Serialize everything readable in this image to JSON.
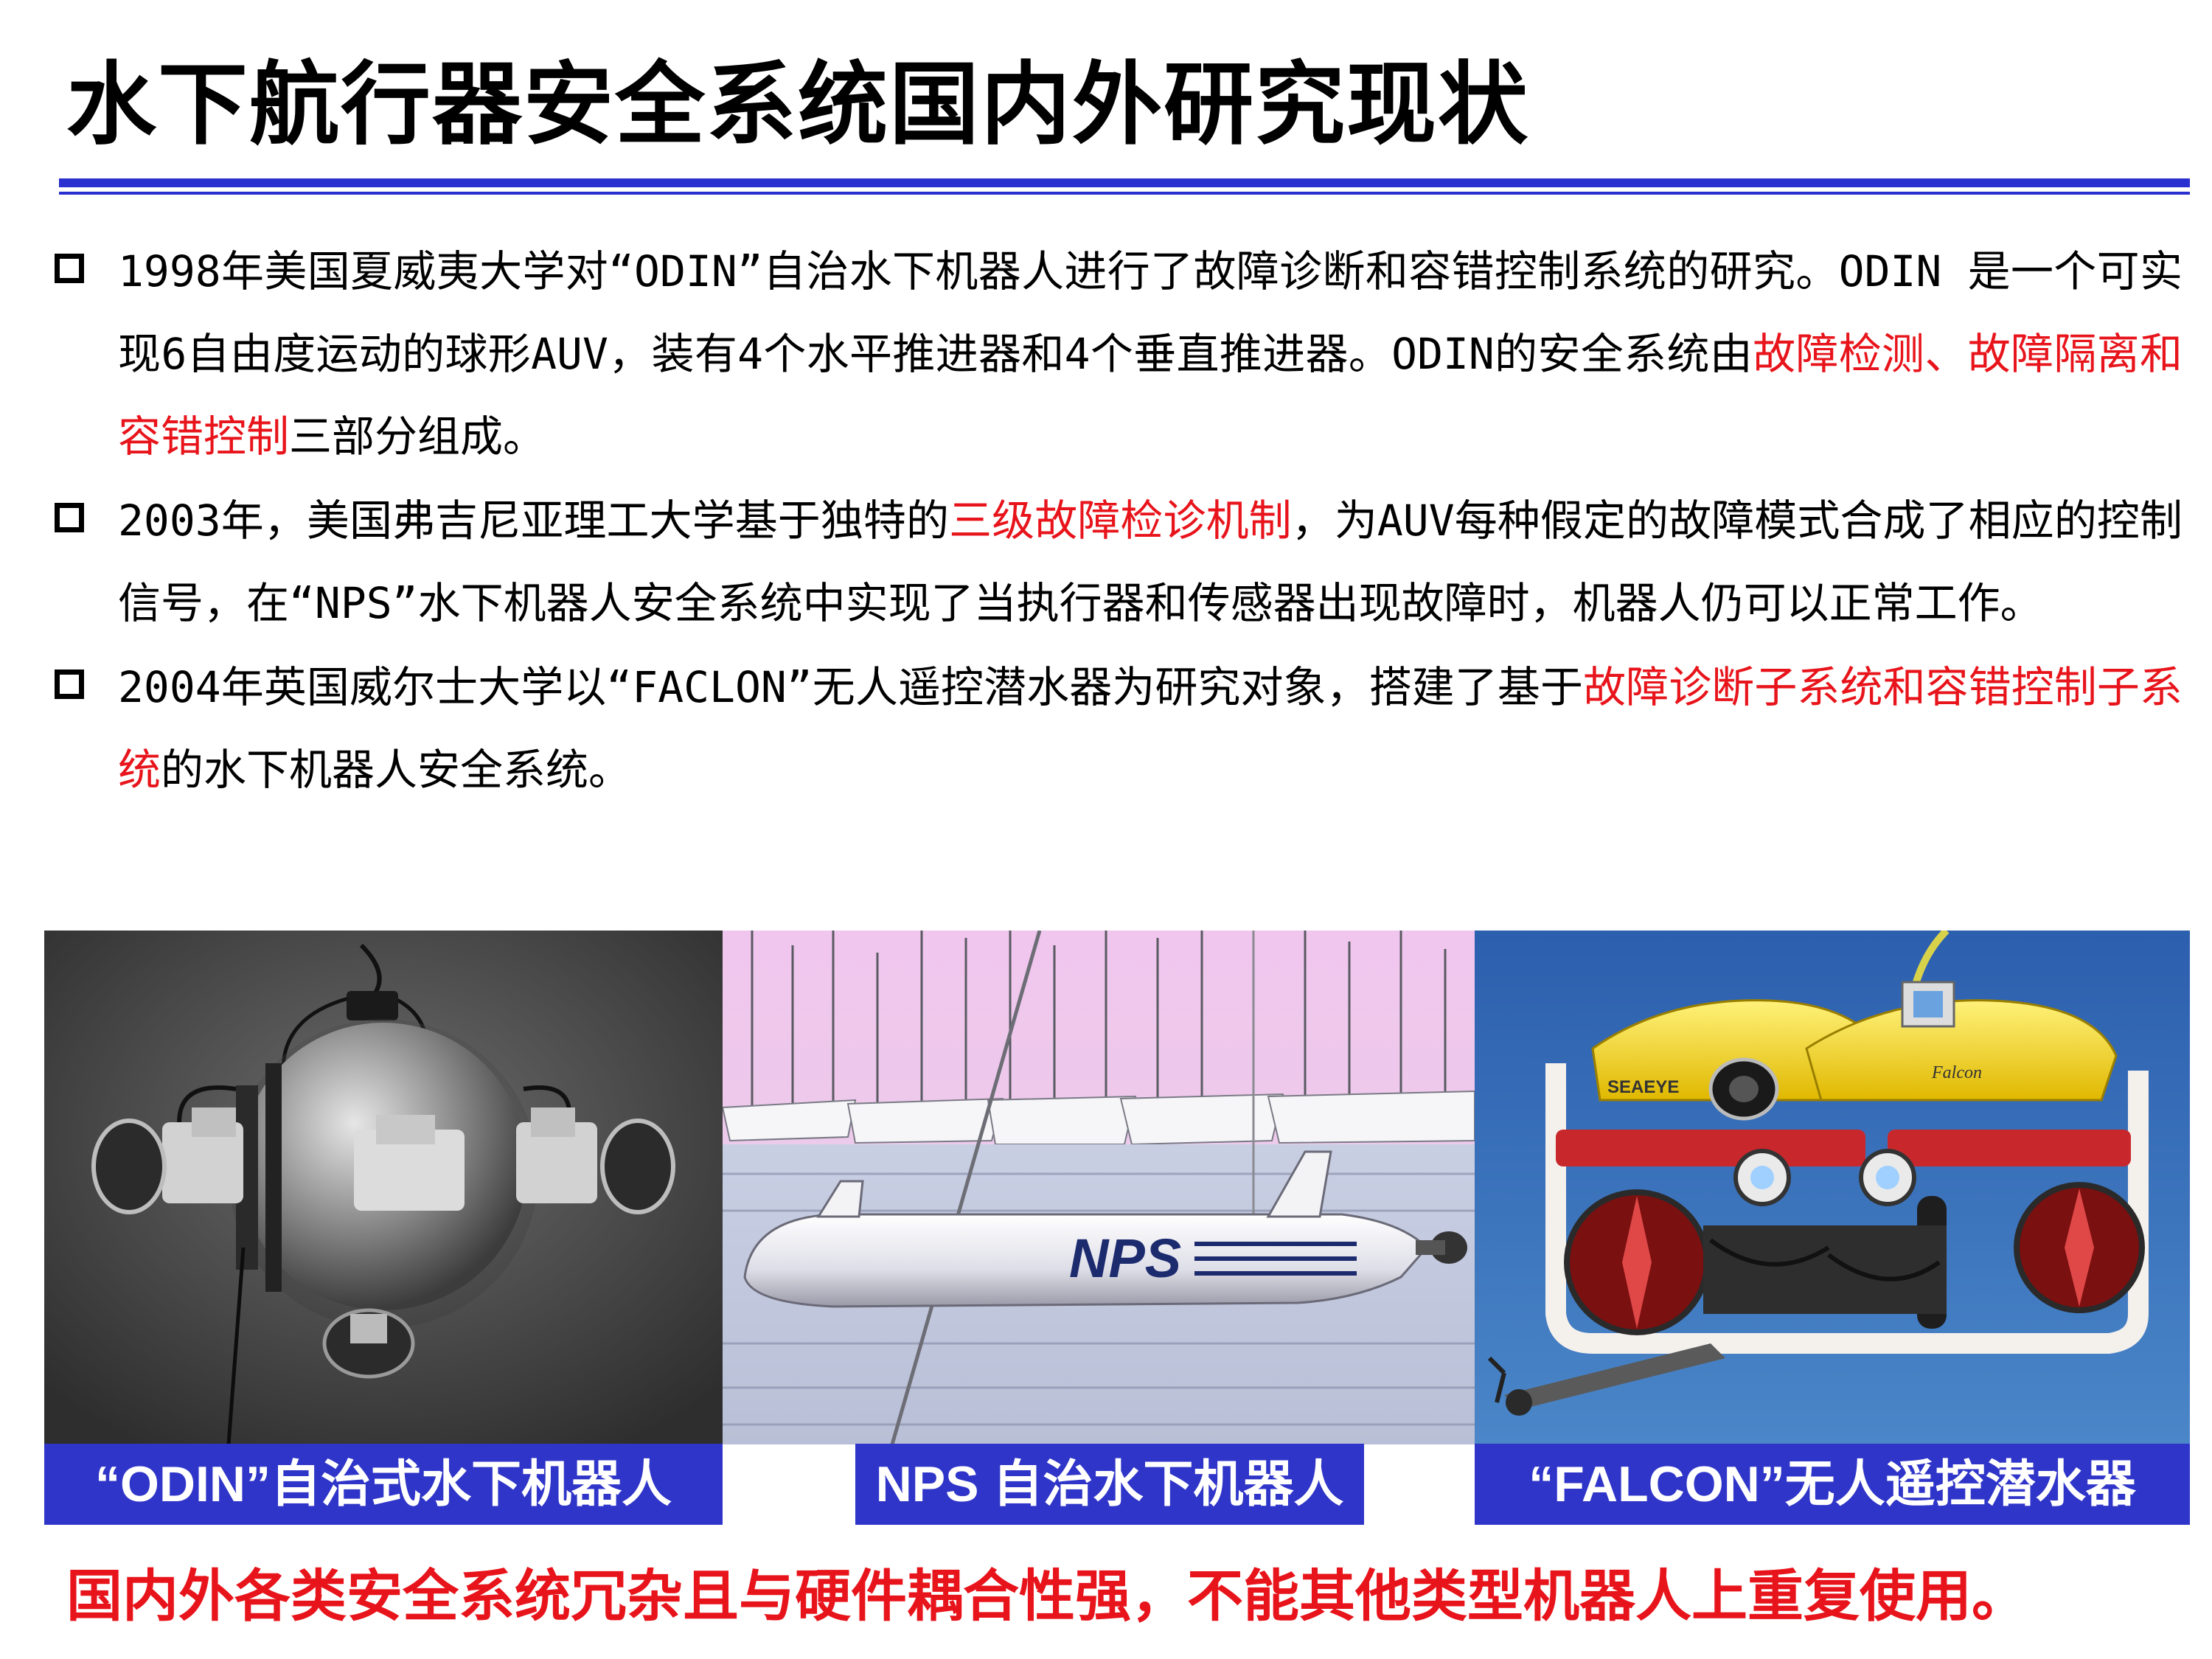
{
  "title": "水下航行器安全系统国内外研究现状",
  "bullets": [
    {
      "segments": [
        {
          "text": "1998年美国夏威夷大学对“ODIN”自治水下机器人进行了故障诊断和容错控制系统的研究。ODIN 是一个可实现6自由度运动的球形AUV，装有4个水平推进器和4个垂直推进器。ODIN的安全系统由",
          "highlight": false
        },
        {
          "text": "故障检测、故障隔离和容错控制",
          "highlight": true
        },
        {
          "text": "三部分组成。",
          "highlight": false
        }
      ]
    },
    {
      "segments": [
        {
          "text": "2003年，美国弗吉尼亚理工大学基于独特的",
          "highlight": false
        },
        {
          "text": "三级故障检诊机制",
          "highlight": true
        },
        {
          "text": "，为AUV每种假定的故障模式合成了相应的控制信号，在“NPS”水下机器人安全系统中实现了当执行器和传感器出现故障时，机器人仍可以正常工作。",
          "highlight": false
        }
      ]
    },
    {
      "segments": [
        {
          "text": "2004年英国威尔士大学以“FACLON”无人遥控潜水器为研究对象，搭建了基于",
          "highlight": false
        },
        {
          "text": "故障诊断子系统和容错控制子系统",
          "highlight": true
        },
        {
          "text": "的水下机器人安全系统。",
          "highlight": false
        }
      ]
    }
  ],
  "photos": {
    "odin": {
      "caption": "“ODIN”自治式水下机器人"
    },
    "nps": {
      "caption": "NPS 自治水下机器人",
      "hull_label": "NPS"
    },
    "falcon": {
      "caption": "“FALCON”无人遥控潜水器",
      "float_label_left": "SEAEYE",
      "float_label_right": "Falcon"
    }
  },
  "conclusion": "国内外各类安全系统冗杂且与硬件耦合性强，不能其他类型机器人上重复使用。",
  "colors": {
    "accent_blue": "#2a2fd0",
    "caption_bg": "#2f35c8",
    "highlight_red": "#e8141b"
  }
}
